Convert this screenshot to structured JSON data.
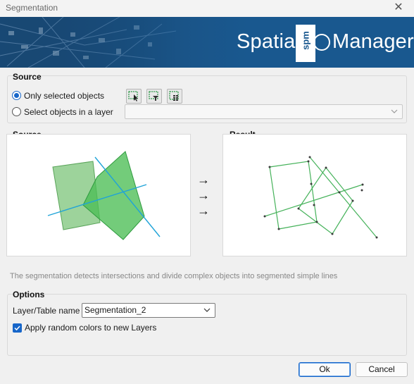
{
  "window": {
    "title": "Segmentation",
    "close_glyph": "✕"
  },
  "banner": {
    "spatial": "Spatial",
    "spm": "spm",
    "manager": "Manager"
  },
  "source_group": {
    "title": "Source",
    "only_selected_label": "Only selected objects",
    "select_in_layer_label": "Select objects in a layer",
    "layer_value": ""
  },
  "preview": {
    "source_title": "Source",
    "result_title": "Result",
    "arrows": [
      "→",
      "→",
      "→"
    ]
  },
  "description": "The segmentation detects intersections and divide complex objects into segmented simple lines",
  "options": {
    "title": "Options",
    "layer_table_label": "Layer/Table name",
    "layer_table_value": "Segmentation_2",
    "random_colors_label": "Apply random colors to new Layers"
  },
  "buttons": {
    "ok": "Ok",
    "cancel": "Cancel"
  },
  "colors": {
    "accent": "#1766c9",
    "banner": "#19588f",
    "green": "#3cb054",
    "cyan": "#1fa3d8"
  },
  "icons": [
    "select-objects-icon",
    "select-filter-icon",
    "select-grid-icon",
    "close-icon",
    "chevron-down-icon"
  ]
}
